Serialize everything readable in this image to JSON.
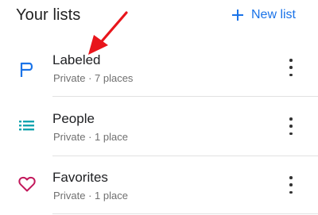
{
  "header": {
    "title": "Your lists",
    "new_list_label": "New list"
  },
  "lists": [
    {
      "title": "Labeled",
      "subtitle": "Private · 7 places",
      "icon": "flag-icon",
      "icon_color": "#1a73e8"
    },
    {
      "title": "People",
      "subtitle": "Private · 1 place",
      "icon": "list-icon",
      "icon_color": "#12a4af"
    },
    {
      "title": "Favorites",
      "subtitle": "Private · 1 place",
      "icon": "heart-icon",
      "icon_color": "#c2185b"
    }
  ],
  "colors": {
    "accent": "#1a73e8",
    "annotation_arrow": "#e8151b"
  }
}
